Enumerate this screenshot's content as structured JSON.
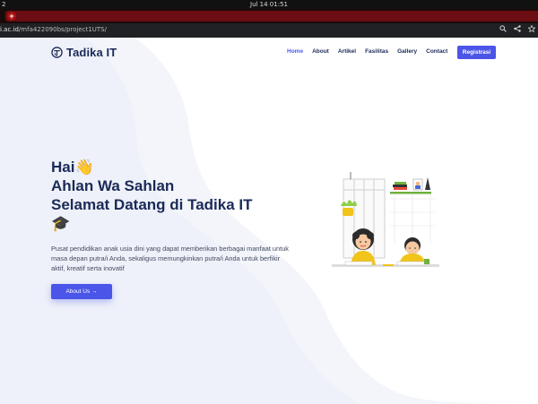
{
  "os": {
    "left_marker": "2",
    "clock": "Jul 14  01:51"
  },
  "browser": {
    "new_tab_symbol": "+",
    "url_host": "i.ac.id",
    "url_path": "/mfa422090bs/project1UTS/",
    "actions": [
      "search-icon",
      "share-icon",
      "star-icon"
    ]
  },
  "nav": {
    "brand": "Tadika IT",
    "links": [
      {
        "label": "Home",
        "active": true
      },
      {
        "label": "About",
        "active": false
      },
      {
        "label": "Artikel",
        "active": false
      },
      {
        "label": "Fasilitas",
        "active": false
      },
      {
        "label": "Gallery",
        "active": false
      },
      {
        "label": "Contact",
        "active": false
      }
    ],
    "register_label": "Registrasi"
  },
  "hero": {
    "greeting": "Hai👋",
    "line2": "Ahlan Wa Sahlan",
    "line3": "Selamat Datang di Tadika IT",
    "line4": "🎓",
    "description": "Pusat pendidikan anak usia dini yang dapat memberikan berbagai manfaat untuk masa depan putra/i Anda, sekaligus memungkinkan putra/i Anda untuk berfikir aktif, kreatif serta inovatif",
    "button_label": "About Us →"
  },
  "colors": {
    "primary": "#4b55e8",
    "navy": "#1b2a57",
    "tab": "#6b0d12",
    "bg_shape": "#f3f5fb"
  }
}
